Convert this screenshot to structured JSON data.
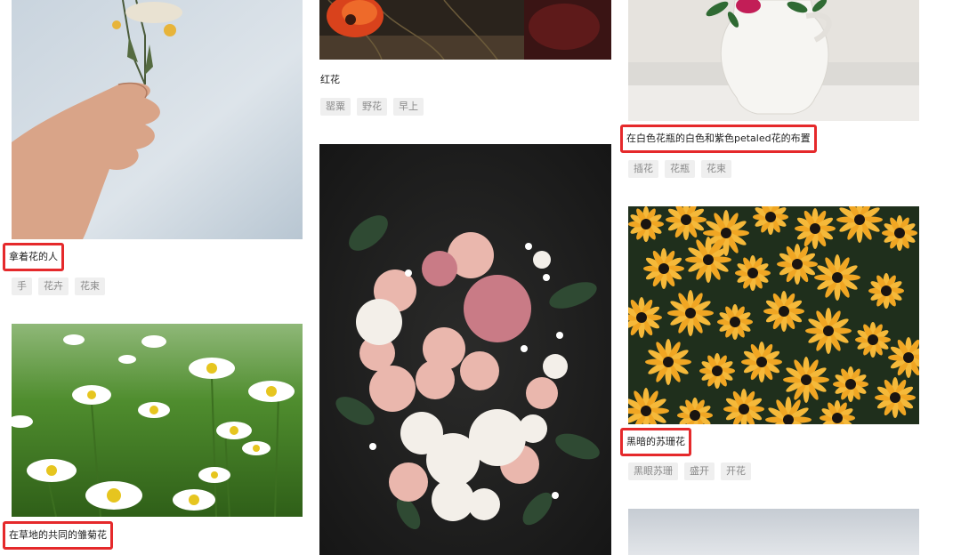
{
  "column1": {
    "card1": {
      "title": "拿着花的人",
      "tags": [
        "手",
        "花卉",
        "花束"
      ]
    },
    "card2": {
      "title": "在草地的共同的雏菊花"
    }
  },
  "column2": {
    "card1": {
      "title": "红花",
      "tags": [
        "罂粟",
        "野花",
        "早上"
      ]
    }
  },
  "column3": {
    "card1": {
      "title": "在白色花瓶的白色和紫色petaled花的布置",
      "tags": [
        "插花",
        "花瓶",
        "花束"
      ]
    },
    "card2": {
      "title": "黑暗的苏珊花",
      "tags": [
        "黑眼苏珊",
        "盛开",
        "开花"
      ]
    }
  },
  "highlight_color": "#e5292b"
}
